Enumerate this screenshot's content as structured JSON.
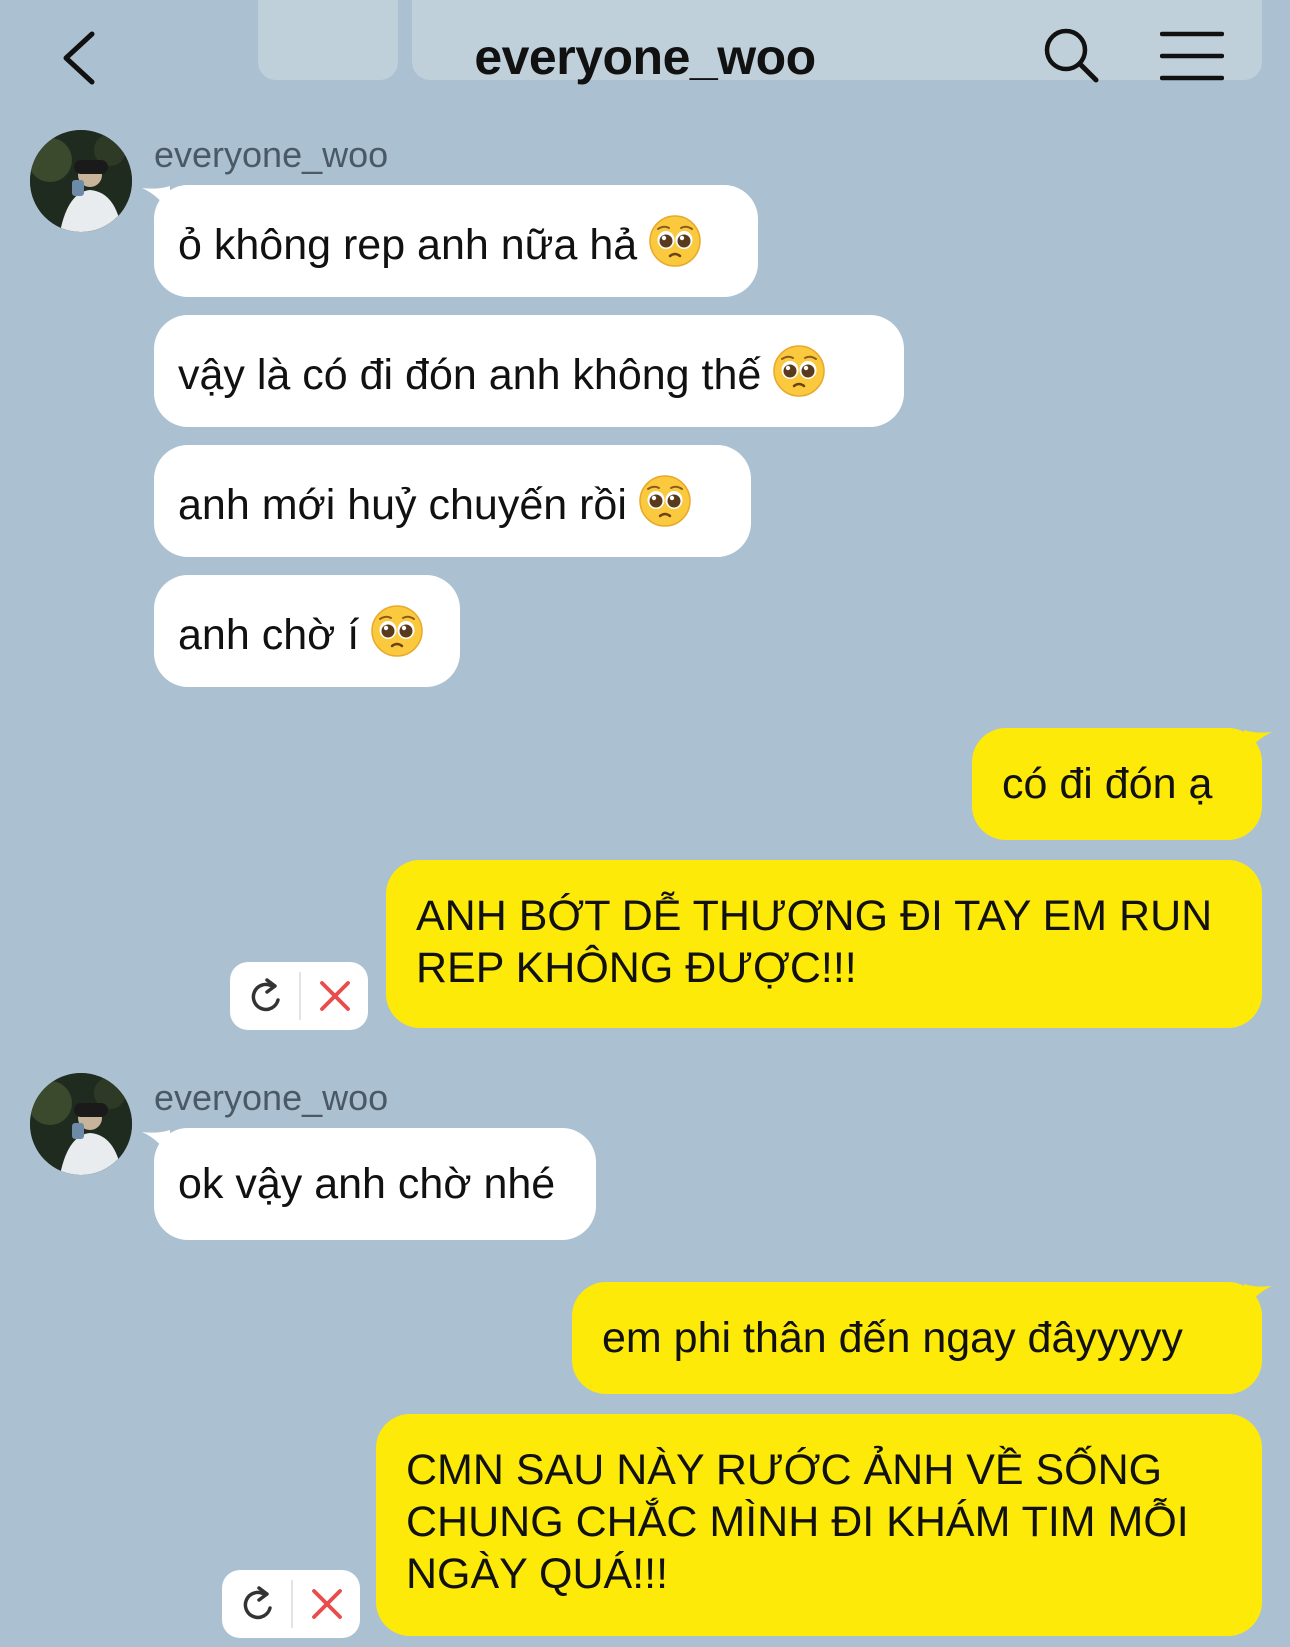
{
  "header": {
    "title": "everyone_woo",
    "back_icon": "chevron-left-icon",
    "search_icon": "search-icon",
    "menu_icon": "hamburger-menu-icon"
  },
  "colors": {
    "background": "#abc1d1",
    "incoming_bubble": "#ffffff",
    "outgoing_bubble": "#fdea08",
    "cancel_red": "#e94c4c"
  },
  "messages": [
    {
      "sender": "everyone_woo",
      "direction": "in",
      "text": "ỏ không rep anh nữa hả",
      "emoji": "pleading-face"
    },
    {
      "direction": "in",
      "text": "vậy là có đi đón anh không thế",
      "emoji": "pleading-face"
    },
    {
      "direction": "in",
      "text": "anh mới huỷ chuyến rồi",
      "emoji": "pleading-face"
    },
    {
      "direction": "in",
      "text": "anh chờ í",
      "emoji": "pleading-face"
    },
    {
      "direction": "out",
      "text": "có đi đón ạ"
    },
    {
      "direction": "out",
      "text": "ANH BỚT DỄ THƯƠNG ĐI TAY EM RUN REP KHÔNG ĐƯỢC!!!",
      "failed": true
    },
    {
      "sender": "everyone_woo",
      "direction": "in",
      "text": "ok vậy anh chờ nhé"
    },
    {
      "direction": "out",
      "text": "em phi thân đến ngay đâyyyyy"
    },
    {
      "direction": "out",
      "text": "CMN SAU NÀY RƯỚC ẢNH VỀ SỐNG CHUNG CHẮC MÌNH ĐI KHÁM TIM MỖI NGÀY QUÁ!!!",
      "failed": true
    }
  ]
}
